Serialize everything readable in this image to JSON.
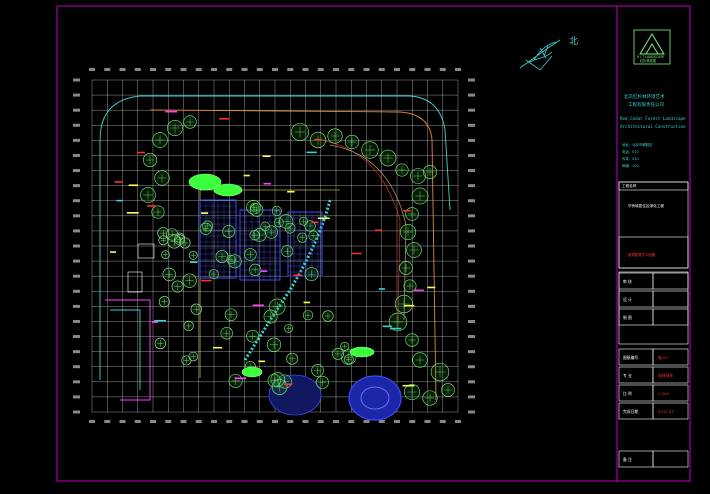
{
  "north_label": "北",
  "logo": {
    "caption_en": "R I T LANDSCAPE",
    "caption_cn": "红杉林景观"
  },
  "company": {
    "name_line1": "北京红杉林环境艺术",
    "name_line2": "工程有限责任公司",
    "name_en_line1": "Red Cedar Forest Landscape",
    "name_en_line2": "Architectural Construction",
    "info": [
      "地址：北京市朝阳区",
      "电话：010",
      "传真：010",
      "邮编：100"
    ]
  },
  "title_block": {
    "project_label": "工程名称",
    "project_value": "华侨城居住区绿化工程",
    "drawing_value": "植物配置总平面图",
    "rows": [
      {
        "label": "审 核",
        "value": ""
      },
      {
        "label": "设 计",
        "value": ""
      },
      {
        "label": "制 图",
        "value": ""
      },
      {
        "label": "图纸编号",
        "value": "施-01"
      },
      {
        "label": "专 业",
        "value": "园林绿化"
      },
      {
        "label": "比 例",
        "value": "1:200"
      },
      {
        "label": "完成日期",
        "value": "2012.03"
      },
      {
        "label": "备 注",
        "value": ""
      }
    ]
  },
  "colors": {
    "frame": "#c000c0",
    "grid": "#d8d8d8",
    "tree": "#7cf07c",
    "tree_fill": "#1c6a1c",
    "cyan": "#3ad2d2",
    "yellow": "#ffff55",
    "red": "#ff3030",
    "blue": "#3c4cff",
    "orange": "#e08a3a",
    "magenta": "#ff40ff"
  }
}
